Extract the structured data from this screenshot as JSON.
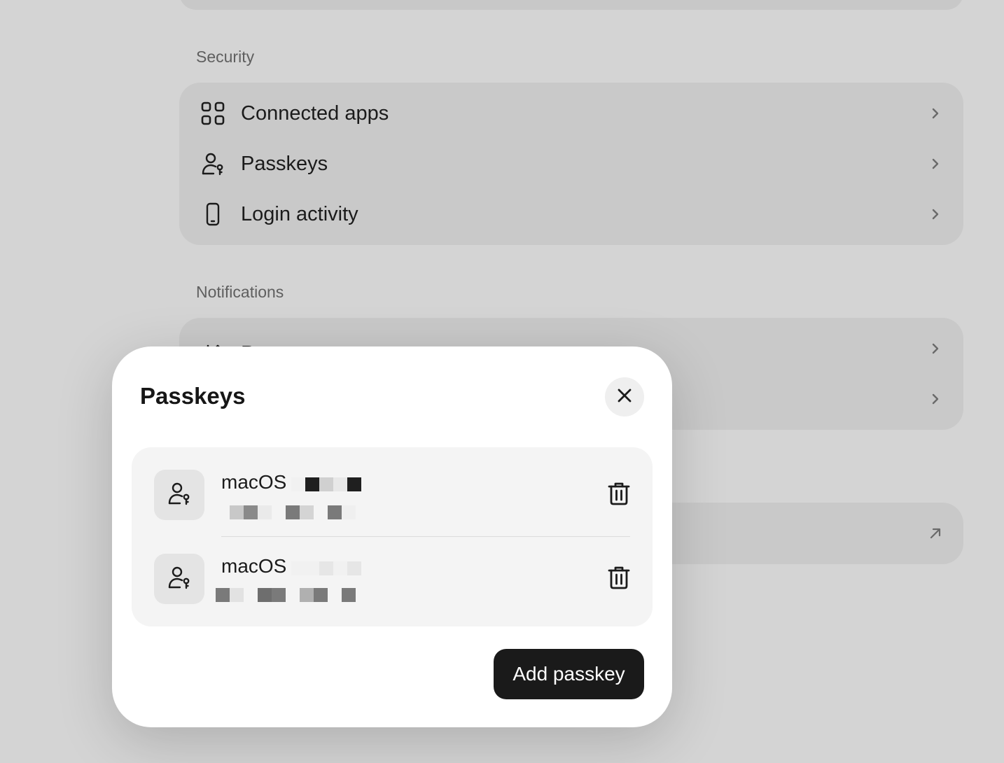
{
  "security": {
    "title": "Security",
    "items": [
      {
        "label": "Connected apps",
        "icon": "grid-icon"
      },
      {
        "label": "Passkeys",
        "icon": "user-key-icon"
      },
      {
        "label": "Login activity",
        "icon": "phone-icon"
      }
    ]
  },
  "notifications": {
    "title": "Notifications",
    "items": [
      {
        "label": "Payments",
        "icon": "transfer-arrows-icon"
      }
    ]
  },
  "modal": {
    "title": "Passkeys",
    "close_icon": "close-icon",
    "passkeys": [
      {
        "name": "macOS",
        "icon": "user-key-icon"
      },
      {
        "name": "macOS",
        "icon": "user-key-icon"
      }
    ],
    "add_label": "Add passkey"
  },
  "colors": {
    "backdrop": "#d4d4d4",
    "card": "#c9c9c9",
    "modal": "#ffffff",
    "list": "#f4f4f4",
    "primary_button": "#1a1a1a"
  }
}
